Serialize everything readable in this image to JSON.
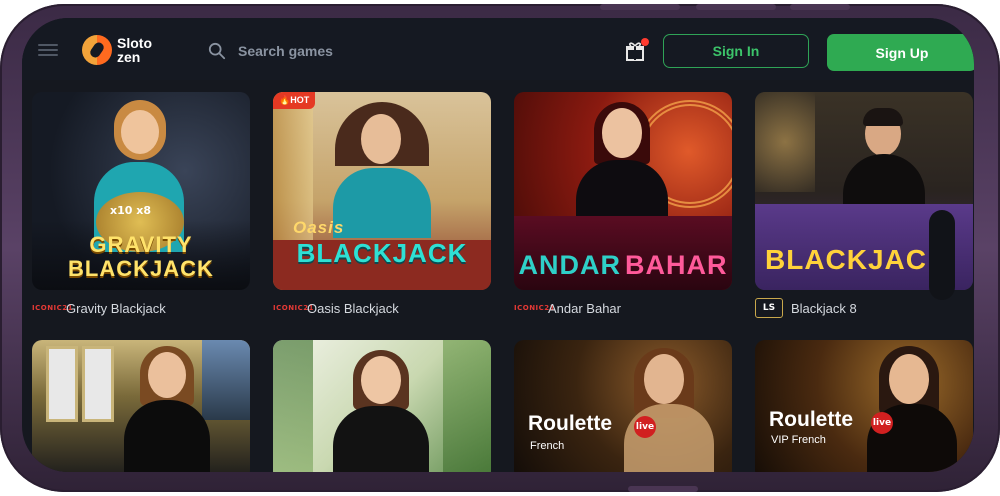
{
  "header": {
    "logo_line1": "Sloto",
    "logo_line2": "zen",
    "search_placeholder": "Search games",
    "signin_label": "Sign In",
    "signup_label": "Sign Up"
  },
  "games": [
    {
      "name": "Gravity Blackjack",
      "provider": "ICONIC21",
      "art_line1": "GRAVITY",
      "art_line2": "BLACKJACK",
      "art_chips": "x10  x8"
    },
    {
      "name": "Oasis Blackjack",
      "provider": "ICONIC21",
      "badge": "HOT",
      "art_line1": "Oasis",
      "art_line2": "BLACKJACK"
    },
    {
      "name": "Andar Bahar",
      "provider": "ICONIC21",
      "art_line1": "ANDAR",
      "art_line2": "BAHAR"
    },
    {
      "name": "Blackjack 8",
      "provider": "LS",
      "art_line1": "BLACKJAC"
    },
    {
      "name": "",
      "provider": ""
    },
    {
      "name": "",
      "provider": ""
    },
    {
      "name": "",
      "art_line1": "Roulette",
      "art_line2": "French",
      "live": "live"
    },
    {
      "name": "",
      "art_line1": "Roulette",
      "art_line2": "VIP French",
      "live": "live"
    }
  ],
  "colors": {
    "brand_green": "#2faa52",
    "hot_red": "#e53923",
    "screen_bg": "#15181f"
  }
}
